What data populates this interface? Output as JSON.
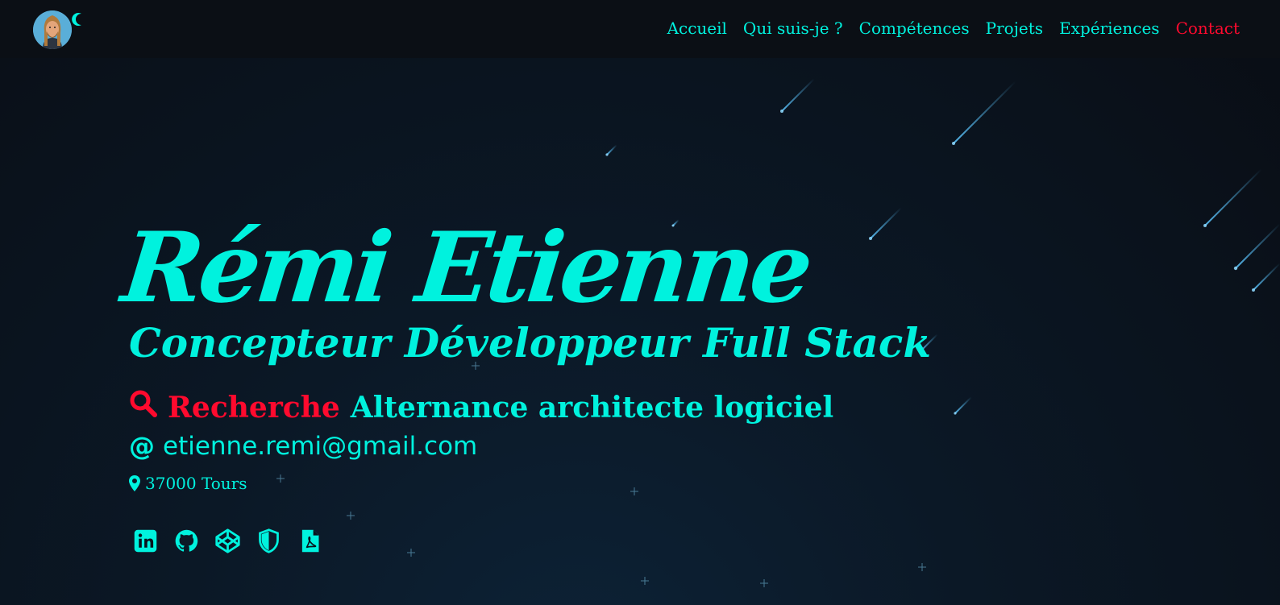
{
  "colors": {
    "accent": "#00f2de",
    "highlight": "#ff0a2e",
    "navbar_bg": "#0b0f15",
    "page_bg": "#0a121c"
  },
  "navbar": {
    "links": [
      {
        "label": "Accueil"
      },
      {
        "label": "Qui suis-je ?"
      },
      {
        "label": "Compétences"
      },
      {
        "label": "Projets"
      },
      {
        "label": "Expériences"
      },
      {
        "label": "Contact",
        "active_color": "#ff0a2e"
      }
    ],
    "toggle_icon": "moon-icon"
  },
  "hero": {
    "name": "Rémi Etienne",
    "subtitle": "Concepteur Développeur Full Stack",
    "search_icon": "search-icon",
    "search_label": "Recherche",
    "search_target": "Alternance architecte logiciel",
    "email_icon": "at-icon",
    "email": "etienne.remi@gmail.com",
    "location_icon": "map-marker-icon",
    "location": "37000 Tours"
  },
  "social": [
    {
      "icon": "linkedin-icon"
    },
    {
      "icon": "github-icon"
    },
    {
      "icon": "codepen-icon"
    },
    {
      "icon": "shield-icon"
    },
    {
      "icon": "pdf-file-icon"
    }
  ]
}
